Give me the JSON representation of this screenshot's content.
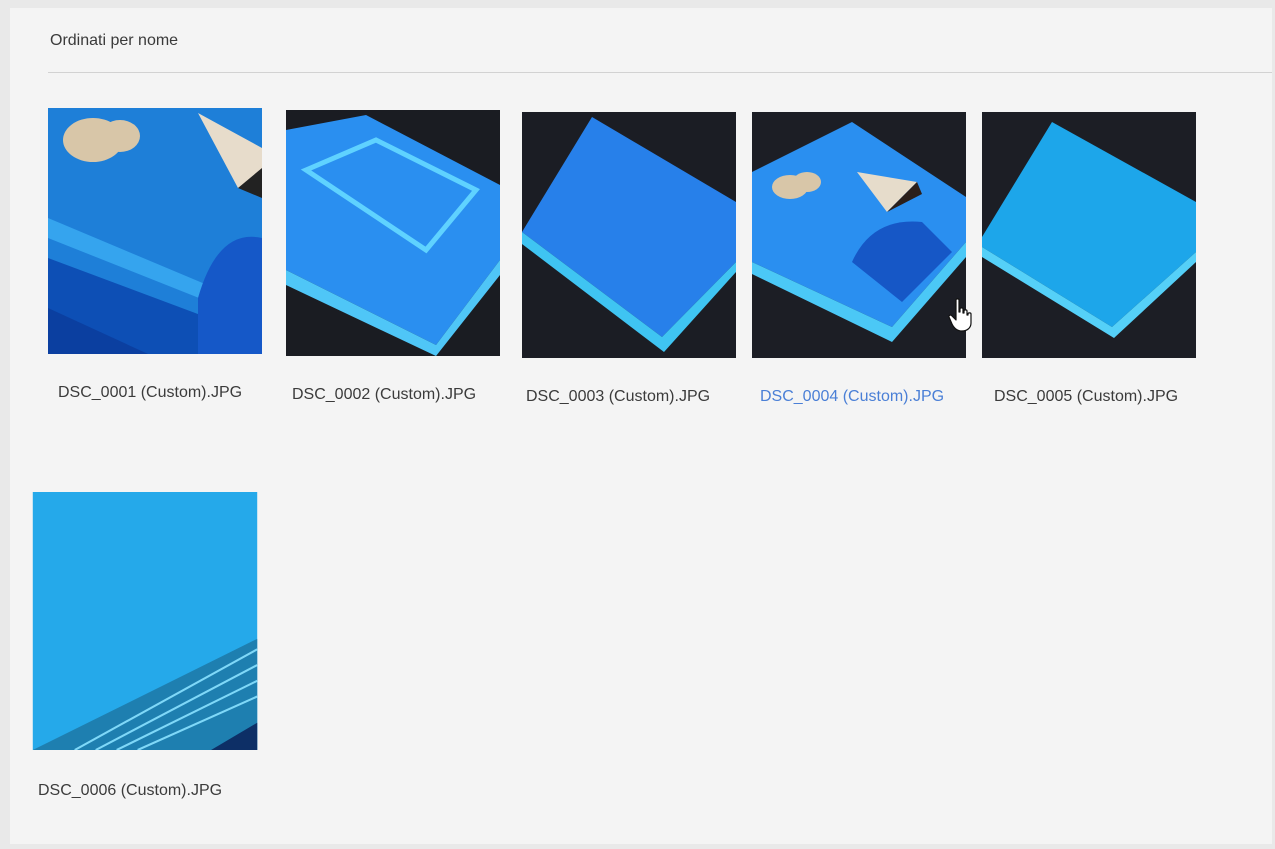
{
  "header": {
    "sort_label": "Ordinati per nome"
  },
  "colors": {
    "selected_caption": "#4a7fd6",
    "caption": "#3b3b3b"
  },
  "files": [
    {
      "name": "DSC_0001 (Custom).JPG",
      "selected": false
    },
    {
      "name": "DSC_0002 (Custom).JPG",
      "selected": false
    },
    {
      "name": "DSC_0003 (Custom).JPG",
      "selected": false
    },
    {
      "name": "DSC_0004 (Custom).JPG",
      "selected": true
    },
    {
      "name": "DSC_0005 (Custom).JPG",
      "selected": false
    },
    {
      "name": "DSC_0006 (Custom).JPG",
      "selected": false
    }
  ],
  "cursor": {
    "icon": "hand-pointer-icon"
  }
}
